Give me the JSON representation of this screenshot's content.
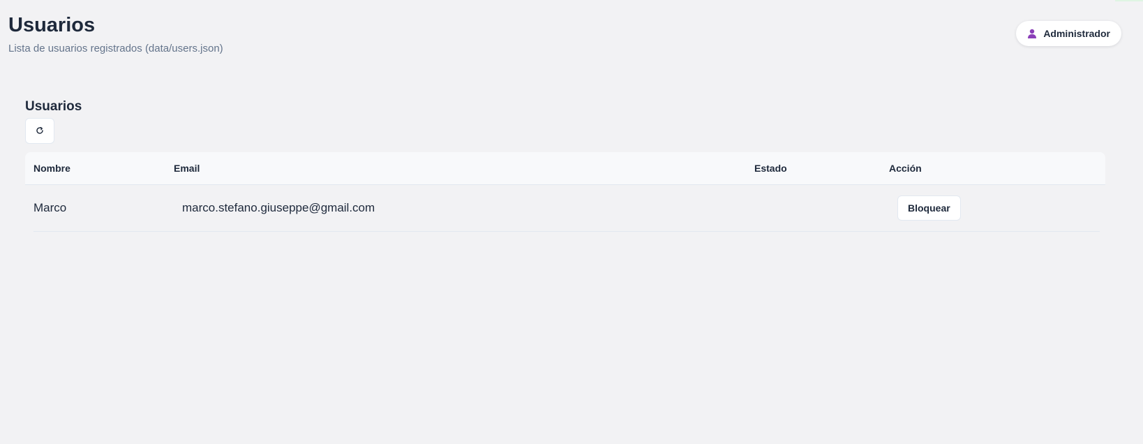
{
  "header": {
    "title": "Usuarios",
    "subtitle": "Lista de usuarios registrados (data/users.json)"
  },
  "user_menu": {
    "label": "Administrador",
    "icon": "user-icon",
    "icon_color": "#8b3fb8"
  },
  "section": {
    "title": "Usuarios",
    "refresh_icon": "refresh-icon"
  },
  "table": {
    "columns": {
      "nombre": "Nombre",
      "email": "Email",
      "estado": "Estado",
      "accion": "Acción"
    },
    "rows": [
      {
        "nombre": "Marco",
        "email": "marco.stefano.giuseppe@gmail.com",
        "estado": "",
        "accion_label": "Bloquear"
      }
    ]
  }
}
